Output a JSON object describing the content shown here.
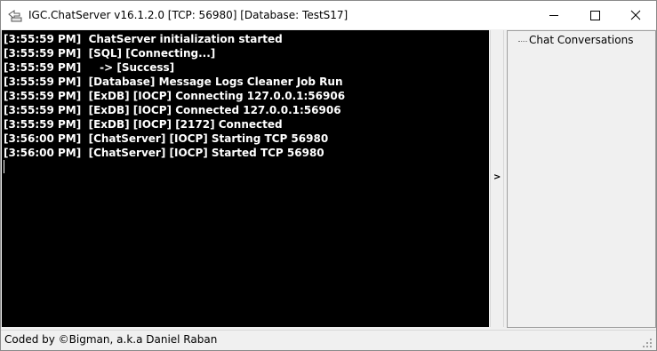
{
  "window": {
    "title": "IGC.ChatServer v16.1.2.0 [TCP: 56980] [Database: TestS17]",
    "minimize_icon": "minimize-icon",
    "maximize_icon": "maximize-icon",
    "close_icon": "close-icon"
  },
  "console": {
    "background": "#000000",
    "text_color": "#ffffff",
    "lines": [
      "[3:55:59 PM]  ChatServer initialization started",
      "[3:55:59 PM]  [SQL] [Connecting...]",
      "[3:55:59 PM]     -> [Success]",
      "[3:55:59 PM]  [Database] Message Logs Cleaner Job Run",
      "[3:55:59 PM]  [ExDB] [IOCP] Connecting 127.0.0.1:56906",
      "[3:55:59 PM]  [ExDB] [IOCP] Connected 127.0.0.1:56906",
      "[3:55:59 PM]  [ExDB] [IOCP] [2172] Connected",
      "[3:56:00 PM]  [ChatServer] [IOCP] Starting TCP 56980",
      "[3:56:00 PM]  [ChatServer] [IOCP] Started TCP 56980"
    ]
  },
  "splitter": {
    "arrow": ">"
  },
  "tree": {
    "root_label": "Chat Conversations"
  },
  "statusbar": {
    "text": "Coded by ©Bigman, a.k.a Daniel Raban"
  }
}
